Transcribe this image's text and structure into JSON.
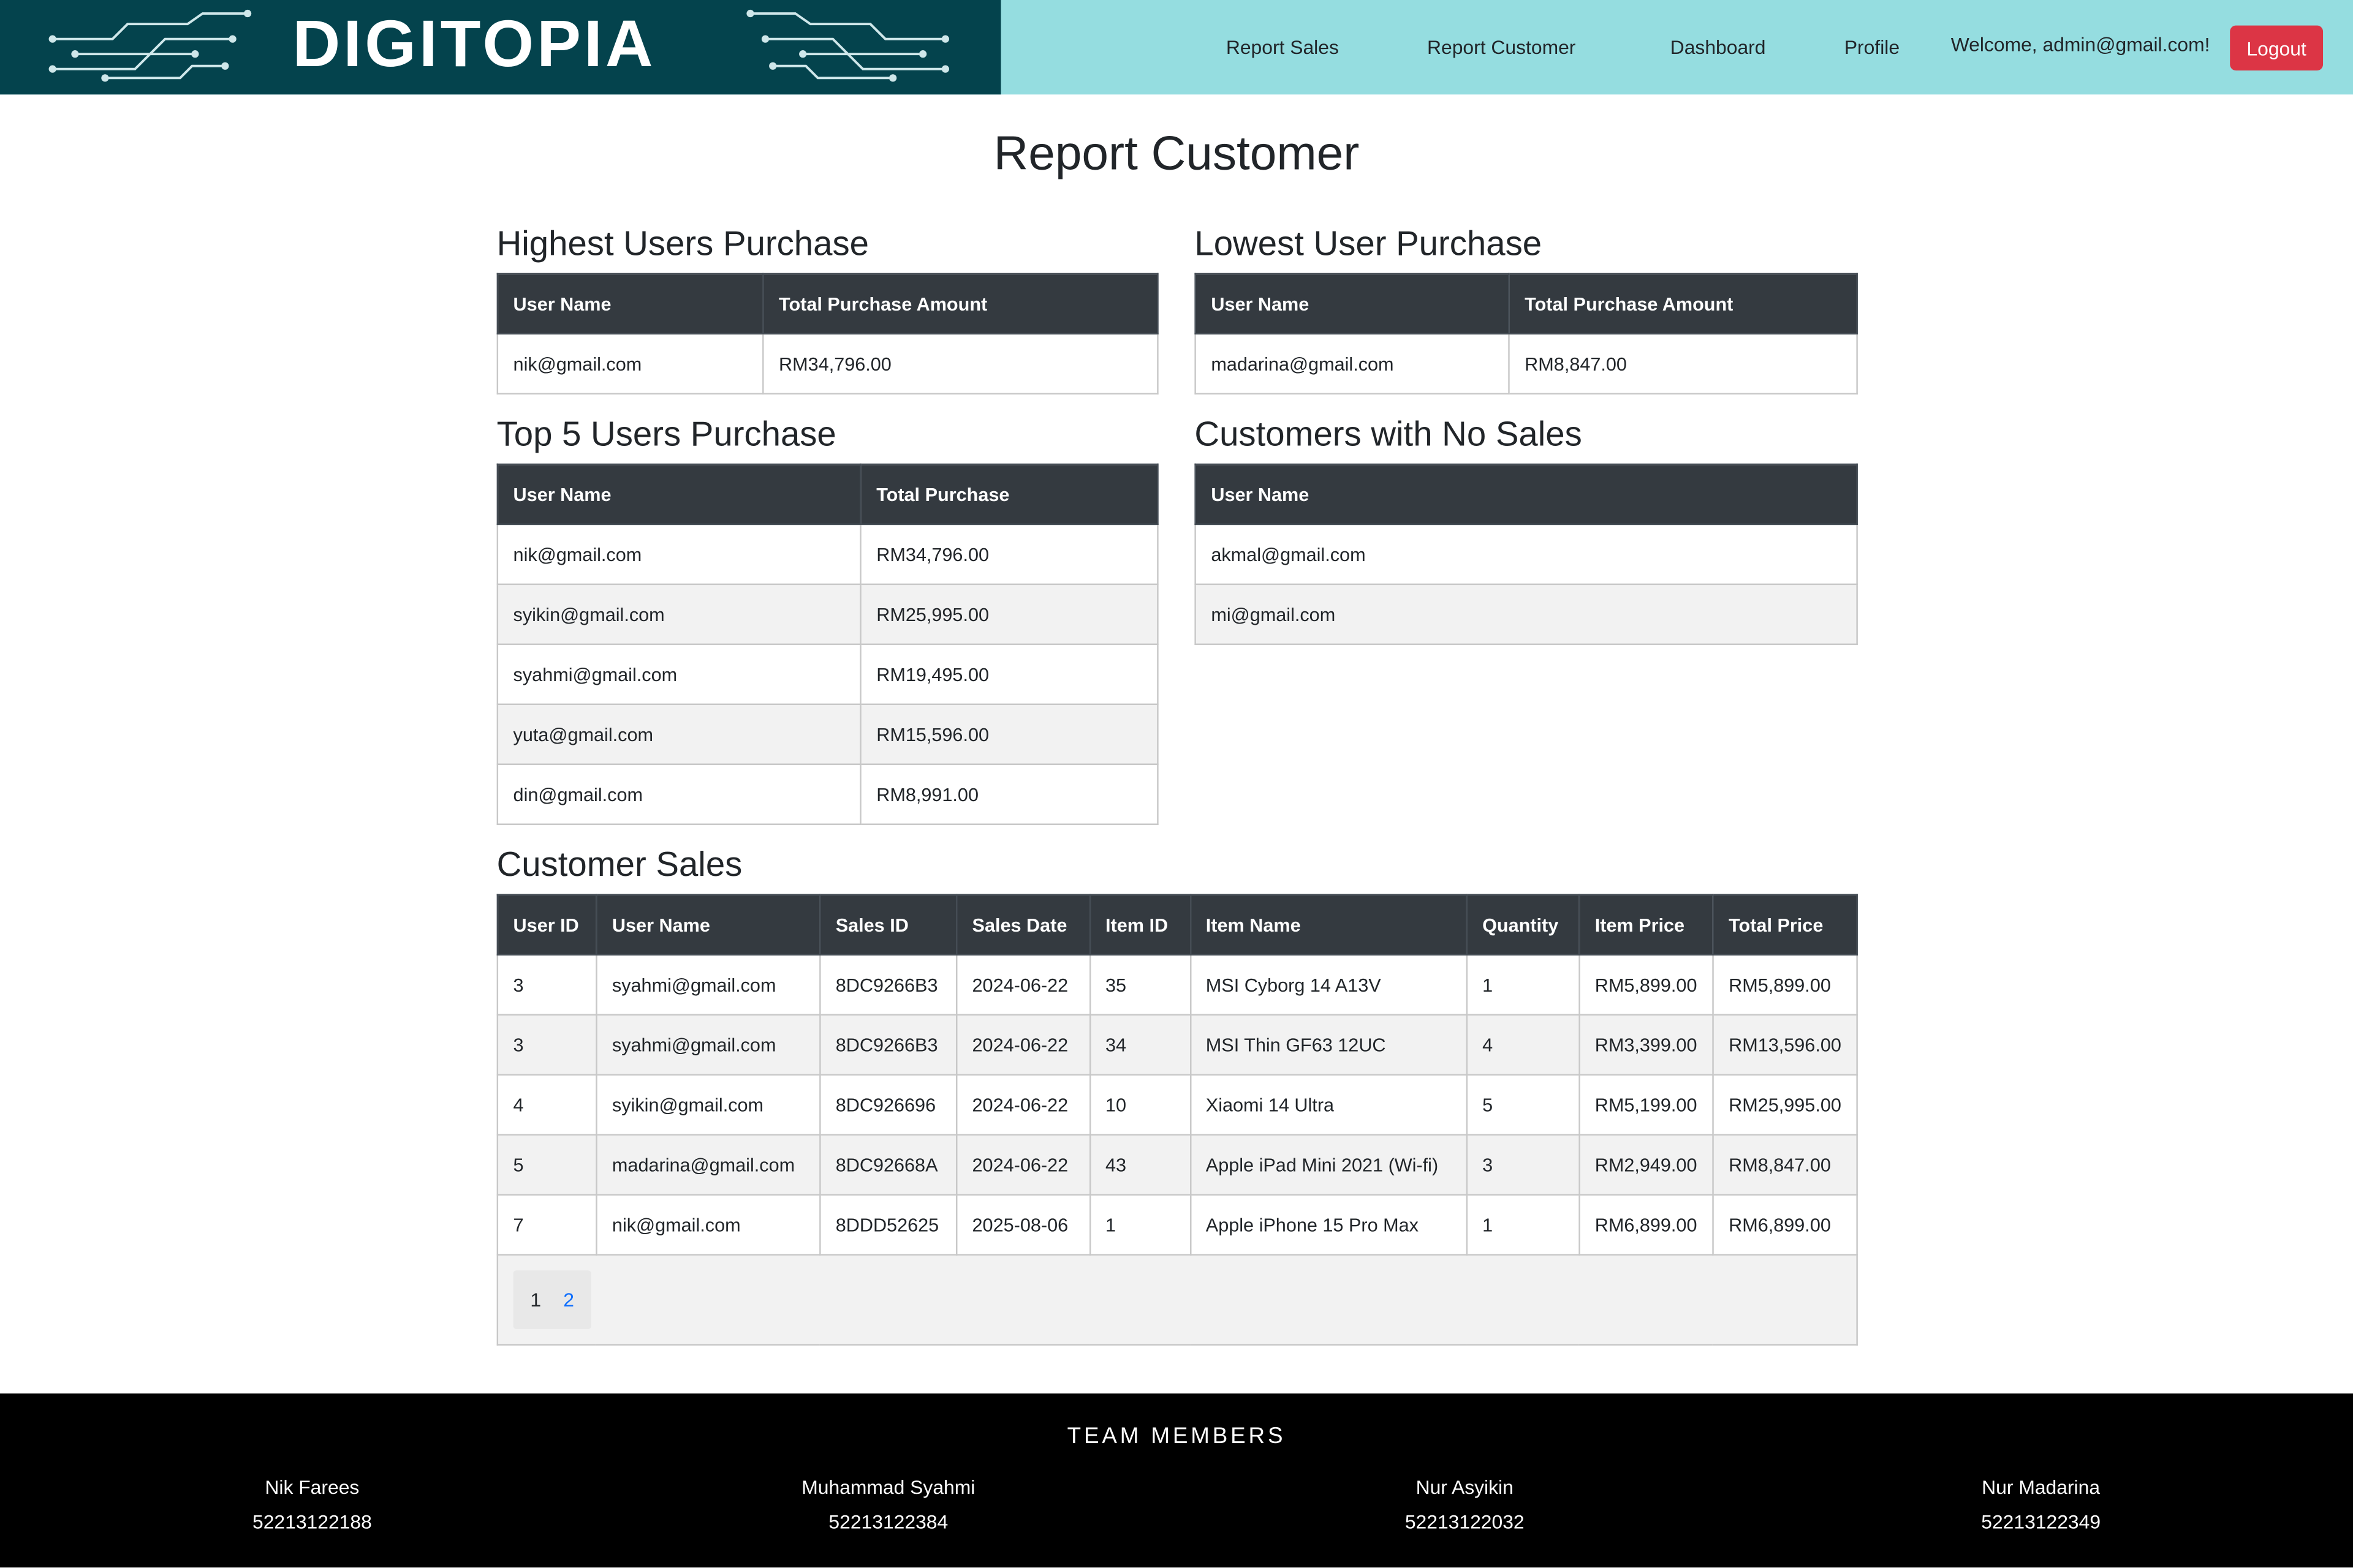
{
  "header": {
    "logo_text": "DIGITOPIA",
    "nav": [
      "Report Sales",
      "Report Customer",
      "Dashboard",
      "Profile"
    ],
    "welcome": "Welcome, admin@gmail.com!",
    "logout_label": "Logout"
  },
  "page_title": "Report Customer",
  "highest": {
    "title": "Highest Users Purchase",
    "headers": [
      "User Name",
      "Total Purchase Amount"
    ],
    "rows": [
      [
        "nik@gmail.com",
        "RM34,796.00"
      ]
    ]
  },
  "lowest": {
    "title": "Lowest User Purchase",
    "headers": [
      "User Name",
      "Total Purchase Amount"
    ],
    "rows": [
      [
        "madarina@gmail.com",
        "RM8,847.00"
      ]
    ]
  },
  "top5": {
    "title": "Top 5 Users Purchase",
    "headers": [
      "User Name",
      "Total Purchase"
    ],
    "rows": [
      [
        "nik@gmail.com",
        "RM34,796.00"
      ],
      [
        "syikin@gmail.com",
        "RM25,995.00"
      ],
      [
        "syahmi@gmail.com",
        "RM19,495.00"
      ],
      [
        "yuta@gmail.com",
        "RM15,596.00"
      ],
      [
        "din@gmail.com",
        "RM8,991.00"
      ]
    ]
  },
  "nosales": {
    "title": "Customers with No Sales",
    "headers": [
      "User Name"
    ],
    "rows": [
      [
        "akmal@gmail.com"
      ],
      [
        "mi@gmail.com"
      ]
    ]
  },
  "sales": {
    "title": "Customer Sales",
    "headers": [
      "User ID",
      "User Name",
      "Sales ID",
      "Sales Date",
      "Item ID",
      "Item Name",
      "Quantity",
      "Item Price",
      "Total Price"
    ],
    "rows": [
      [
        "3",
        "syahmi@gmail.com",
        "8DC9266B3",
        "2024-06-22",
        "35",
        "MSI Cyborg 14 A13V",
        "1",
        "RM5,899.00",
        "RM5,899.00"
      ],
      [
        "3",
        "syahmi@gmail.com",
        "8DC9266B3",
        "2024-06-22",
        "34",
        "MSI Thin GF63 12UC",
        "4",
        "RM3,399.00",
        "RM13,596.00"
      ],
      [
        "4",
        "syikin@gmail.com",
        "8DC926696",
        "2024-06-22",
        "10",
        "Xiaomi 14 Ultra",
        "5",
        "RM5,199.00",
        "RM25,995.00"
      ],
      [
        "5",
        "madarina@gmail.com",
        "8DC92668A",
        "2024-06-22",
        "43",
        "Apple iPad Mini 2021 (Wi-fi)",
        "3",
        "RM2,949.00",
        "RM8,847.00"
      ],
      [
        "7",
        "nik@gmail.com",
        "8DDD52625",
        "2025-08-06",
        "1",
        "Apple iPhone 15 Pro Max",
        "1",
        "RM6,899.00",
        "RM6,899.00"
      ]
    ],
    "pages": [
      "1",
      "2"
    ]
  },
  "footer": {
    "title": "TEAM MEMBERS",
    "members": [
      {
        "name": "Nik Farees",
        "id": "52213122188"
      },
      {
        "name": "Muhammad Syahmi",
        "id": "52213122384"
      },
      {
        "name": "Nur Asyikin",
        "id": "52213122032"
      },
      {
        "name": "Nur Madarina",
        "id": "52213122349"
      }
    ]
  },
  "colors": {
    "header_bg": "#95dde0",
    "logo_bg": "#04434d",
    "table_head": "#343a40",
    "logout": "#dc3545",
    "footer": "#000000"
  }
}
